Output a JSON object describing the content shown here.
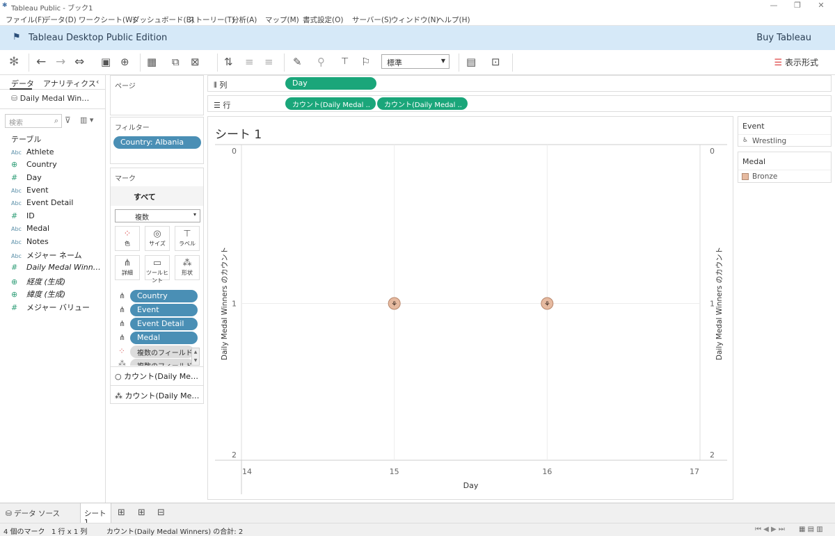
{
  "window": {
    "title": "Tableau Public - ブック1",
    "minimize": "—",
    "restore": "❐",
    "close": "✕"
  },
  "menu": [
    "ファイル(F)",
    "データ(D)",
    "ワークシート(W)",
    "ダッシュボード(B)",
    "ストーリー(T)",
    "分析(A)",
    "マップ(M)",
    "書式設定(O)",
    "サーバー(S)",
    "ウィンドウ(N)",
    "ヘルプ(H)"
  ],
  "banner": {
    "name": "Tableau Desktop Public Edition",
    "buy": "Buy Tableau"
  },
  "toolbar": {
    "zoom_value": "標準",
    "show_me": "表示形式"
  },
  "left_pane": {
    "tabs": [
      "データ",
      "アナリティクス"
    ],
    "datasource": "Daily Medal Win…",
    "search_placeholder": "検索",
    "section": "テーブル",
    "fields": [
      {
        "name": "Athlete",
        "type": "Abc"
      },
      {
        "name": "Country",
        "type": "geo"
      },
      {
        "name": "Day",
        "type": "#"
      },
      {
        "name": "Event",
        "type": "Abc"
      },
      {
        "name": "Event Detail",
        "type": "Abc"
      },
      {
        "name": "ID",
        "type": "#"
      },
      {
        "name": "Medal",
        "type": "Abc"
      },
      {
        "name": "Notes",
        "type": "Abc"
      },
      {
        "name": "メジャー ネーム",
        "type": "Abc"
      },
      {
        "name": "Daily Medal Winn…",
        "type": "#"
      },
      {
        "name": "経度 (生成)",
        "type": "geo"
      },
      {
        "name": "緯度 (生成)",
        "type": "geo"
      },
      {
        "name": "メジャー バリュー",
        "type": "#"
      }
    ]
  },
  "cards": {
    "pages": "ページ",
    "filters": "フィルター",
    "filter_pill": "Country: Albania",
    "marks": "マーク",
    "marks_all": "すべて",
    "mark_type": "複数",
    "mark_buttons": [
      "色",
      "サイズ",
      "ラベル",
      "詳細",
      "ツールヒント",
      "形状"
    ],
    "mark_pills": [
      "Country",
      "Event",
      "Event Detail",
      "Medal"
    ],
    "multi_field": "複数のフィールド",
    "multi_field2": "複数のフィールド",
    "measure_cards": [
      "カウント(Daily Me…",
      "カウント(Daily Me…"
    ]
  },
  "shelves": {
    "columns_label": "列",
    "rows_label": "行",
    "columns_pill": "Day",
    "rows_pills": [
      "カウント(Daily Medal ..",
      "カウント(Daily Medal .."
    ]
  },
  "sheet": {
    "title": "シート 1",
    "y_left_label": "Daily Medal Winners のカウント",
    "y_right_label": "Daily Medal Winners のカウント",
    "x_label": "Day"
  },
  "chart_data": {
    "type": "scatter",
    "title": "シート 1",
    "xlabel": "Day",
    "ylabel": "Daily Medal Winners のカウント",
    "xlim": [
      14,
      17
    ],
    "ylim": [
      0,
      2
    ],
    "y_reversed": true,
    "x_ticks": [
      14,
      15,
      16,
      17
    ],
    "y_ticks": [
      0,
      1,
      2
    ],
    "points": [
      {
        "x": 15,
        "y": 1
      },
      {
        "x": 16,
        "y": 1
      }
    ],
    "marker": "wrestling-shape",
    "marker_color": "#e6baa0",
    "grid": true
  },
  "legends": {
    "event_title": "Event",
    "event_item": "Wrestling",
    "medal_title": "Medal",
    "medal_item": "Bronze",
    "medal_color": "#e6baa0"
  },
  "bottom_tabs": {
    "datasource": "データ ソース",
    "sheet": "シート 1"
  },
  "status": {
    "marks": "4 個のマーク",
    "rowscols": "1 行 x 1 列",
    "sum": "カウント(Daily Medal Winners) の合計: 2"
  }
}
